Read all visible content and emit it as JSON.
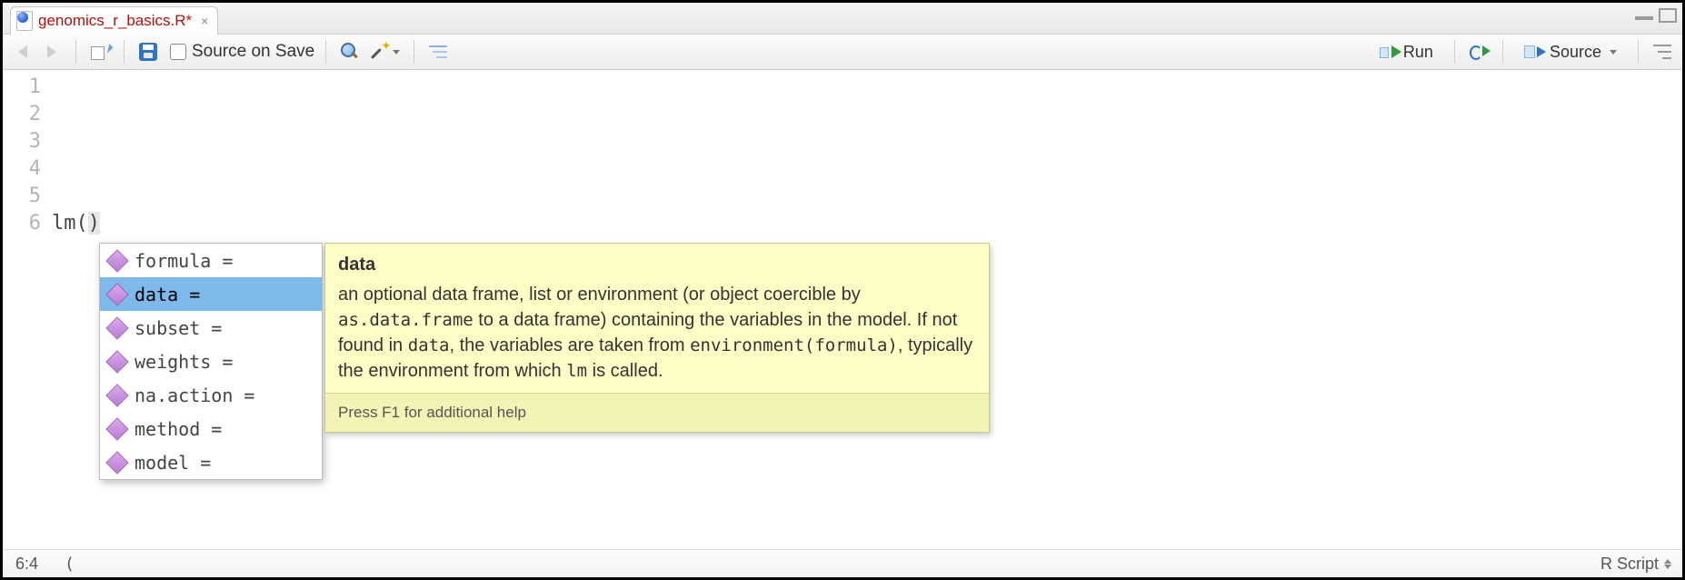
{
  "tab": {
    "filename": "genomics_r_basics.R*",
    "close_glyph": "×"
  },
  "toolbar": {
    "source_on_save_label": "Source on Save",
    "run_label": "Run",
    "source_label": "Source"
  },
  "editor": {
    "gutter_lines": [
      "1",
      "2",
      "3",
      "4",
      "5",
      "6"
    ],
    "code_lines": [
      "",
      "",
      "",
      "",
      "",
      "lm()"
    ],
    "cursor": {
      "line": 6,
      "col": 4
    }
  },
  "autocomplete": {
    "selected_index": 1,
    "items": [
      {
        "label": "formula ="
      },
      {
        "label": "data ="
      },
      {
        "label": "subset ="
      },
      {
        "label": "weights ="
      },
      {
        "label": "na.action ="
      },
      {
        "label": "method ="
      },
      {
        "label": "model ="
      }
    ]
  },
  "tooltip": {
    "title": "data",
    "body_parts": {
      "p1": "an optional data frame, list or environment (or object coercible by ",
      "c1": "as.data.frame",
      "p2": " to a data frame) containing the variables in the model. If not found in ",
      "c2": "data",
      "p3": ", the variables are taken from ",
      "c3": "environment(formula)",
      "p4": ", typically the environment from which ",
      "c4": "lm",
      "p5": " is called."
    },
    "footer": "Press F1 for additional help"
  },
  "status": {
    "position": "6:4",
    "context": "(",
    "filetype": "R Script"
  }
}
